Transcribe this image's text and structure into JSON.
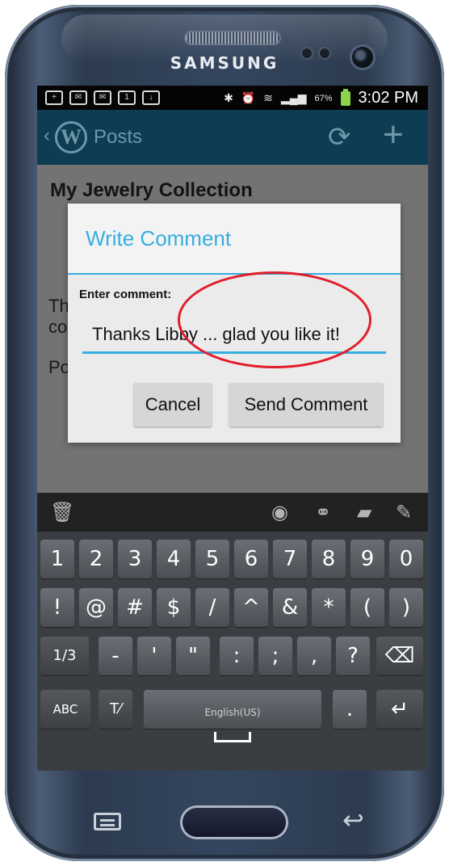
{
  "device": {
    "brand": "SAMSUNG"
  },
  "status_bar": {
    "battery_percent": "67%",
    "time": "3:02 PM",
    "left_icons": [
      "plus-box",
      "mail",
      "mail",
      "calendar",
      "download"
    ]
  },
  "action_bar": {
    "title": "Posts",
    "refresh_label": "refresh",
    "add_label": "add"
  },
  "content": {
    "post_title": "My Jewelry Collection",
    "snippet_lines": [
      "Th",
      "co",
      "Po"
    ]
  },
  "dialog": {
    "title": "Write Comment",
    "field_label": "Enter comment:",
    "comment_value": "Thanks Libby ... glad you like it!",
    "cancel_label": "Cancel",
    "send_label": "Send Comment"
  },
  "toolbar": {
    "icons": [
      "trash-icon",
      "eye-icon",
      "share-icon",
      "comment-icon",
      "edit-icon"
    ]
  },
  "keyboard": {
    "row1": [
      "1",
      "2",
      "3",
      "4",
      "5",
      "6",
      "7",
      "8",
      "9",
      "0"
    ],
    "row2": [
      "!",
      "@",
      "#",
      "$",
      "/",
      "^",
      "&",
      "*",
      "(",
      ")"
    ],
    "row3_page": "1/3",
    "row3": [
      "-",
      "'",
      "\"",
      ":",
      ";",
      ",",
      "?"
    ],
    "abc_label": "ABC",
    "space_label": "English(US)",
    "period_label": "."
  },
  "colors": {
    "accent": "#35aee0",
    "action_bar": "#0c3d52",
    "highlight": "#e21d2a"
  }
}
